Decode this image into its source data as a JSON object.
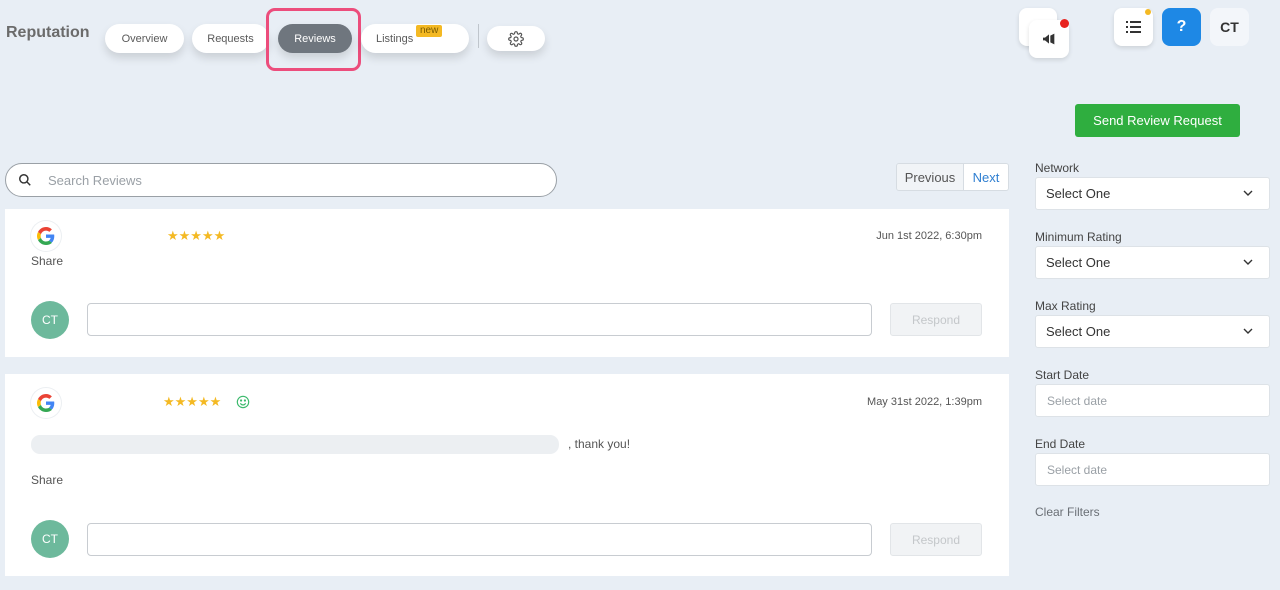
{
  "header": {
    "title": "Reputation",
    "tabs": [
      {
        "label": "Overview",
        "active": false
      },
      {
        "label": "Requests",
        "active": false
      },
      {
        "label": "Reviews",
        "active": true
      },
      {
        "label": "Listings",
        "active": false,
        "badge": "new"
      }
    ],
    "settings_icon": "gear-icon",
    "notifications_icon": "megaphone-icon",
    "tasks_icon": "list-icon",
    "help_label": "?",
    "user_initials": "CT"
  },
  "actions": {
    "send_review_request": "Send Review Request"
  },
  "search": {
    "placeholder": "Search Reviews",
    "value": ""
  },
  "pagination": {
    "previous": "Previous",
    "next": "Next"
  },
  "reviews": [
    {
      "network": "google",
      "rating": 5,
      "stars": "★★★★★",
      "date": "Jun 1st 2022, 6:30pm",
      "text": "",
      "share": "Share",
      "responder_initials": "CT",
      "reply_value": "",
      "respond_label": "Respond"
    },
    {
      "network": "google",
      "rating": 5,
      "stars": "★★★★★",
      "sentiment_icon": "smile-icon",
      "date": "May 31st 2022, 1:39pm",
      "text": ", thank you!",
      "share": "Share",
      "responder_initials": "CT",
      "reply_value": "",
      "respond_label": "Respond"
    }
  ],
  "filters": {
    "network": {
      "label": "Network",
      "value": "Select One"
    },
    "min_rating": {
      "label": "Minimum Rating",
      "value": "Select One"
    },
    "max_rating": {
      "label": "Max Rating",
      "value": "Select One"
    },
    "start_date": {
      "label": "Start Date",
      "placeholder": "Select date"
    },
    "end_date": {
      "label": "End Date",
      "placeholder": "Select date"
    },
    "clear": "Clear Filters"
  },
  "colors": {
    "active_tab": "#6f767e",
    "highlight": "#ec4d7c",
    "primary_green": "#2fae3f",
    "help_blue": "#1e88e5",
    "star": "#f4b923",
    "avatar": "#6db99c"
  }
}
